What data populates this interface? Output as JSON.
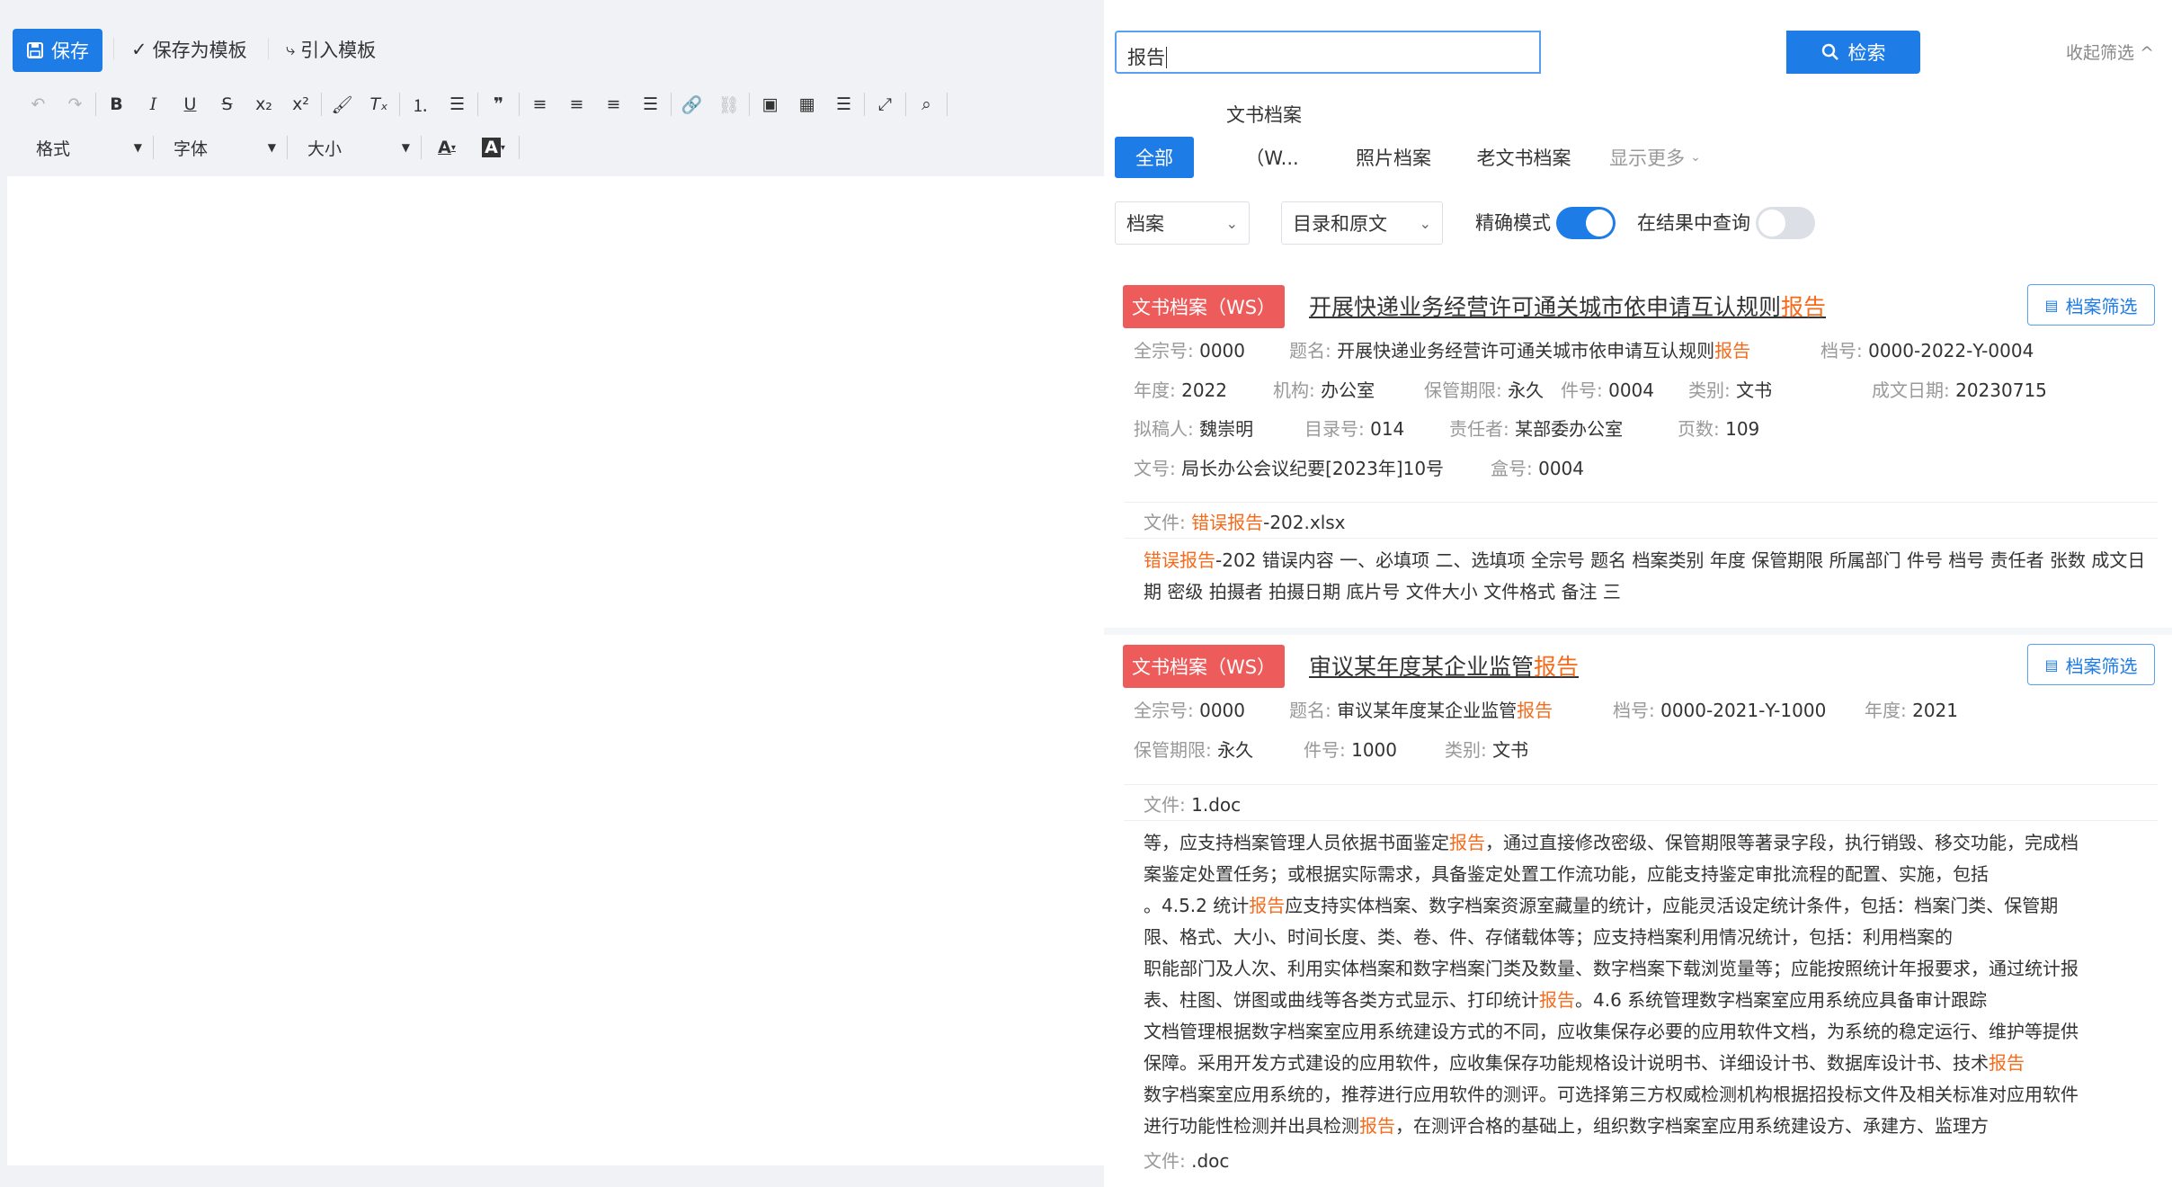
{
  "toolbar": {
    "save_label": "保存",
    "save_as_template_label": "保存为模板",
    "import_template_label": "引入模板"
  },
  "editor": {
    "format_label": "格式",
    "font_label": "字体",
    "size_label": "大小"
  },
  "search": {
    "value": "报告",
    "button_label": "检索",
    "collapse_label": "收起筛选"
  },
  "categories": {
    "group_label": "文书档案",
    "tabs": [
      "全部",
      "（W...",
      "照片档案",
      "老文书档案"
    ],
    "more_label": "显示更多"
  },
  "filters": {
    "scope_value": "档案",
    "mode_value": "目录和原文",
    "exact_label": "精确模式",
    "exact_on": true,
    "within_label": "在结果中查询",
    "within_on": false
  },
  "results": [
    {
      "badge": "文书档案（WS）",
      "title_pre": "开展快递业务经营许可通关城市依申请互认规则",
      "title_hl": "报告",
      "filter_label": "档案筛选",
      "meta": [
        {
          "k": "全宗号:",
          "v": "0000"
        },
        {
          "k": "题名:",
          "v": "开展快递业务经营许可通关城市依申请互认规则",
          "hl": "报告"
        },
        {
          "k": "档号:",
          "v": "0000-2022-Y-0004"
        },
        {
          "k": "年度:",
          "v": "2022"
        },
        {
          "k": "机构:",
          "v": "办公室"
        },
        {
          "k": "保管期限:",
          "v": "永久"
        },
        {
          "k": "件号:",
          "v": "0004"
        },
        {
          "k": "类别:",
          "v": "文书"
        },
        {
          "k": "成文日期:",
          "v": "20230715"
        },
        {
          "k": "拟稿人:",
          "v": "魏崇明"
        },
        {
          "k": "目录号:",
          "v": "014"
        },
        {
          "k": "责任者:",
          "v": "某部委办公室"
        },
        {
          "k": "页数:",
          "v": "109"
        },
        {
          "k": "文号:",
          "v": "局长办公会议纪要[2023年]10号"
        },
        {
          "k": "盒号:",
          "v": "0004"
        }
      ],
      "file_key": "文件:",
      "file_hl": "错误报告",
      "file_rest": "-202.xlsx",
      "snippet_hl": "错误报告",
      "snippet_rest": "-202 错误内容 一、必填项 二、选填项 全宗号 题名 档案类别 年度 保管期限 所属部门 件号 档号 责任者 张数 成文日期 密级 拍摄者 拍摄日期 底片号 文件大小 文件格式 备注 三"
    },
    {
      "badge": "文书档案（WS）",
      "title_pre": "审议某年度某企业监管",
      "title_hl": "报告",
      "filter_label": "档案筛选",
      "meta": [
        {
          "k": "全宗号:",
          "v": "0000"
        },
        {
          "k": "题名:",
          "v": "审议某年度某企业监管",
          "hl": "报告"
        },
        {
          "k": "档号:",
          "v": "0000-2021-Y-1000"
        },
        {
          "k": "年度:",
          "v": "2021"
        },
        {
          "k": "保管期限:",
          "v": "永久"
        },
        {
          "k": "件号:",
          "v": "1000"
        },
        {
          "k": "类别:",
          "v": "文书"
        }
      ],
      "file_key": "文件:",
      "file_name": "1.doc",
      "snippet_lines": [
        [
          "等，应支持档案管理人员依据书面鉴定",
          "报告",
          "，通过直接修改密级、保管期限等著录字段，执行销毁、移交功能，完成档"
        ],
        [
          "案鉴定处置任务；或根据实际需求，具备鉴定处置工作流功能，应能支持鉴定审批流程的配置、实施，包括"
        ],
        [
          "。4.5.2 统计",
          "报告",
          "应支持实体档案、数字档案资源室藏量的统计，应能灵活设定统计条件，包括：档案门类、保管期"
        ],
        [
          "限、格式、大小、时间长度、类、卷、件、存储载体等；应支持档案利用情况统计，包括：利用档案的"
        ],
        [
          "职能部门及人次、利用实体档案和数字档案门类及数量、数字档案下载浏览量等；应能按照统计年报要求，通过统计报"
        ],
        [
          "表、柱图、饼图或曲线等各类方式显示、打印统计",
          "报告",
          "。4.6 系统管理数字档案室应用系统应具备审计跟踪"
        ],
        [
          "文档管理根据数字档案室应用系统建设方式的不同，应收集保存必要的应用软件文档，为系统的稳定运行、维护等提供"
        ],
        [
          "保障。采用开发方式建设的应用软件，应收集保存功能规格设计说明书、详细设计书、数据库设计书、技术",
          "报告"
        ],
        [
          "数字档案室应用系统的，推荐进行应用软件的测评。可选择第三方权威检测机构根据招投标文件及相关标准对应用软件"
        ],
        [
          "进行功能性检测并出具检测",
          "报告",
          "，在测评合格的基础上，组织数字档案室应用系统建设方、承建方、监理方"
        ]
      ],
      "file2_key": "文件:",
      "file2_name": ".doc"
    }
  ]
}
